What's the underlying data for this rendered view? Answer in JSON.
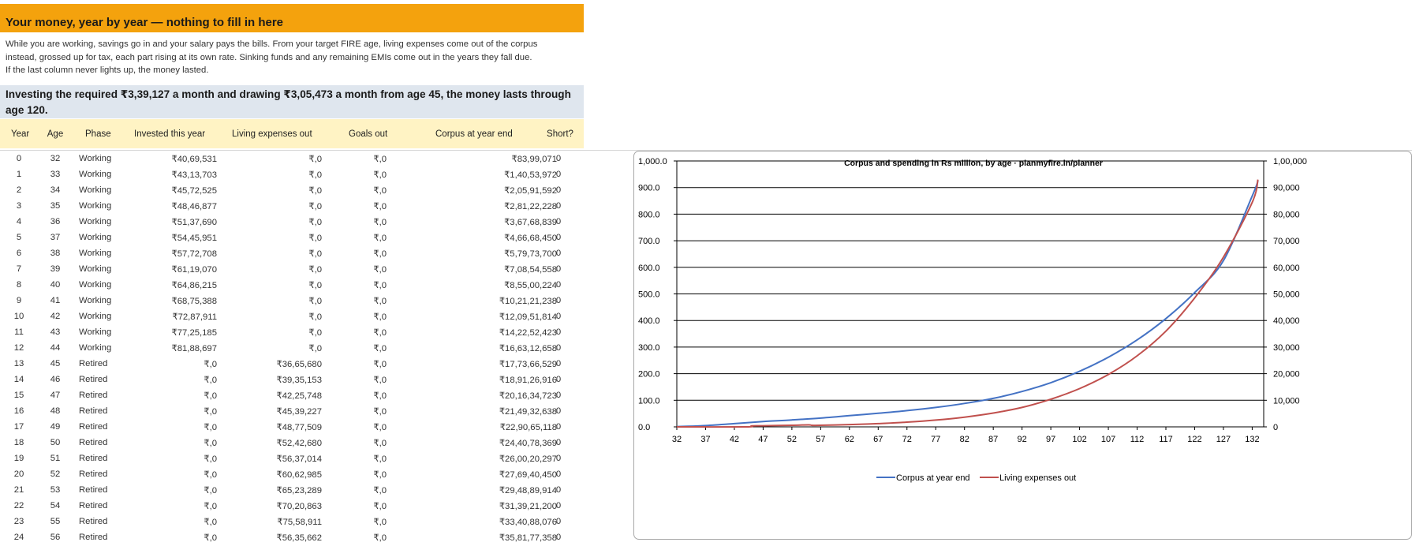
{
  "header": {
    "title": "Your money, year by year — nothing to fill in here"
  },
  "intro": {
    "lines": [
      "While you are working, savings go in and your salary pays the bills. From your target FIRE age, living expenses come out of the corpus",
      "instead, grossed up for tax, each part rising at its own rate. Sinking funds and any remaining EMIs come out in the years they fall due.",
      "If the last column never lights up, the money lasted."
    ]
  },
  "summary": {
    "text": "Investing the required ₹3,39,127 a month and drawing ₹3,05,473 a month from age 45, the money lasts through age 120."
  },
  "table": {
    "columns": [
      "Year",
      "Age",
      "Phase",
      "Invested this year",
      "Living expenses out",
      "Goals out",
      "Corpus at year end",
      "Short?"
    ],
    "rows": [
      [
        "0",
        "32",
        "Working",
        "₹40,69,531",
        "₹,0",
        "₹,0",
        "₹83,99,071",
        "0"
      ],
      [
        "1",
        "33",
        "Working",
        "₹43,13,703",
        "₹,0",
        "₹,0",
        "₹1,40,53,972",
        "0"
      ],
      [
        "2",
        "34",
        "Working",
        "₹45,72,525",
        "₹,0",
        "₹,0",
        "₹2,05,91,592",
        "0"
      ],
      [
        "3",
        "35",
        "Working",
        "₹48,46,877",
        "₹,0",
        "₹,0",
        "₹2,81,22,228",
        "0"
      ],
      [
        "4",
        "36",
        "Working",
        "₹51,37,690",
        "₹,0",
        "₹,0",
        "₹3,67,68,839",
        "0"
      ],
      [
        "5",
        "37",
        "Working",
        "₹54,45,951",
        "₹,0",
        "₹,0",
        "₹4,66,68,450",
        "0"
      ],
      [
        "6",
        "38",
        "Working",
        "₹57,72,708",
        "₹,0",
        "₹,0",
        "₹5,79,73,700",
        "0"
      ],
      [
        "7",
        "39",
        "Working",
        "₹61,19,070",
        "₹,0",
        "₹,0",
        "₹7,08,54,558",
        "0"
      ],
      [
        "8",
        "40",
        "Working",
        "₹64,86,215",
        "₹,0",
        "₹,0",
        "₹8,55,00,224",
        "0"
      ],
      [
        "9",
        "41",
        "Working",
        "₹68,75,388",
        "₹,0",
        "₹,0",
        "₹10,21,21,238",
        "0"
      ],
      [
        "10",
        "42",
        "Working",
        "₹72,87,911",
        "₹,0",
        "₹,0",
        "₹12,09,51,814",
        "0"
      ],
      [
        "11",
        "43",
        "Working",
        "₹77,25,185",
        "₹,0",
        "₹,0",
        "₹14,22,52,423",
        "0"
      ],
      [
        "12",
        "44",
        "Working",
        "₹81,88,697",
        "₹,0",
        "₹,0",
        "₹16,63,12,658",
        "0"
      ],
      [
        "13",
        "45",
        "Retired",
        "₹,0",
        "₹36,65,680",
        "₹,0",
        "₹17,73,66,529",
        "0"
      ],
      [
        "14",
        "46",
        "Retired",
        "₹,0",
        "₹39,35,153",
        "₹,0",
        "₹18,91,26,916",
        "0"
      ],
      [
        "15",
        "47",
        "Retired",
        "₹,0",
        "₹42,25,748",
        "₹,0",
        "₹20,16,34,723",
        "0"
      ],
      [
        "16",
        "48",
        "Retired",
        "₹,0",
        "₹45,39,227",
        "₹,0",
        "₹21,49,32,638",
        "0"
      ],
      [
        "17",
        "49",
        "Retired",
        "₹,0",
        "₹48,77,509",
        "₹,0",
        "₹22,90,65,118",
        "0"
      ],
      [
        "18",
        "50",
        "Retired",
        "₹,0",
        "₹52,42,680",
        "₹,0",
        "₹24,40,78,369",
        "0"
      ],
      [
        "19",
        "51",
        "Retired",
        "₹,0",
        "₹56,37,014",
        "₹,0",
        "₹26,00,20,297",
        "0"
      ],
      [
        "20",
        "52",
        "Retired",
        "₹,0",
        "₹60,62,985",
        "₹,0",
        "₹27,69,40,450",
        "0"
      ],
      [
        "21",
        "53",
        "Retired",
        "₹,0",
        "₹65,23,289",
        "₹,0",
        "₹29,48,89,914",
        "0"
      ],
      [
        "22",
        "54",
        "Retired",
        "₹,0",
        "₹70,20,863",
        "₹,0",
        "₹31,39,21,200",
        "0"
      ],
      [
        "23",
        "55",
        "Retired",
        "₹,0",
        "₹75,58,911",
        "₹,0",
        "₹33,40,88,076",
        "0"
      ],
      [
        "24",
        "56",
        "Retired",
        "₹,0",
        "₹56,35,662",
        "₹,0",
        "₹35,81,77,358",
        "0"
      ]
    ]
  },
  "chart_data": {
    "type": "line",
    "title": "Corpus and spending in Rs million, by age · planmyfire.in/planner",
    "x_ticks": [
      "32",
      "37",
      "42",
      "47",
      "52",
      "57",
      "62",
      "67",
      "72",
      "77",
      "82",
      "87",
      "92",
      "97",
      "102",
      "107",
      "112",
      "117",
      "122",
      "127",
      "132"
    ],
    "y_left_ticks": [
      "0.0",
      "100.0",
      "200.0",
      "300.0",
      "400.0",
      "500.0",
      "600.0",
      "700.0",
      "800.0",
      "900.0",
      "1,000.0"
    ],
    "y_right_ticks": [
      "0",
      "10,000",
      "20,000",
      "30,000",
      "40,000",
      "50,000",
      "60,000",
      "70,000",
      "80,000",
      "90,000",
      "1,00,000"
    ],
    "xlim": [
      32,
      134
    ],
    "ylim_left": [
      0,
      1000
    ],
    "ylim_right": [
      0,
      100000
    ],
    "grid": "horizontal",
    "legend_position": "bottom",
    "series": [
      {
        "name": "Corpus at year end",
        "axis": "left",
        "color": "#4472c4",
        "x": [
          32,
          37,
          42,
          47,
          52,
          57,
          62,
          67,
          72,
          77,
          82,
          87,
          92,
          97,
          102,
          107,
          112,
          117,
          122,
          127,
          132,
          133
        ],
        "y": [
          0.8,
          4.7,
          12.1,
          20.2,
          26,
          33,
          42,
          51,
          61,
          73,
          88,
          107,
          133,
          166,
          209,
          262,
          327,
          407,
          505,
          625,
          868,
          925
        ]
      },
      {
        "name": "Living expenses out",
        "axis": "right",
        "color": "#c0504d",
        "x": [
          32,
          44,
          45,
          47,
          52,
          55,
          56,
          62,
          67,
          72,
          77,
          82,
          87,
          92,
          97,
          102,
          107,
          112,
          117,
          122,
          127,
          132,
          133
        ],
        "y": [
          0,
          0,
          366,
          423,
          606,
          756,
          564,
          857,
          1230,
          1770,
          2540,
          3640,
          5200,
          7300,
          10400,
          14400,
          19700,
          26700,
          36000,
          48500,
          63800,
          84400,
          93000
        ]
      }
    ]
  },
  "colors": {
    "header_bg": "#f4a20d",
    "summary_bg": "#dfe6ee",
    "table_header_bg": "#fff3c4"
  }
}
